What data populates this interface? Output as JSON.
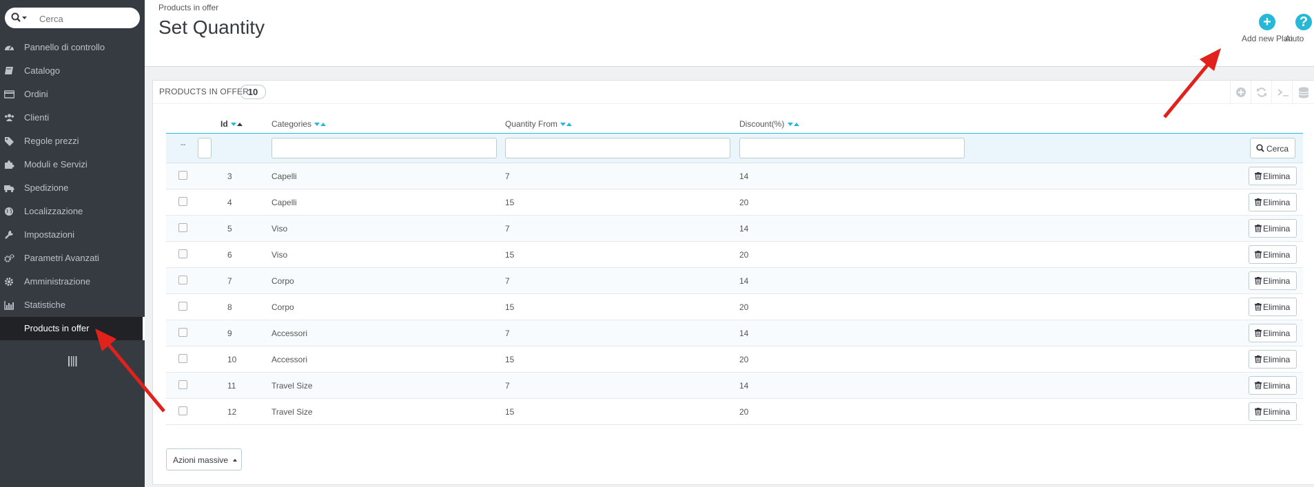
{
  "sidebar": {
    "search_placeholder": "Cerca",
    "items": [
      {
        "label": "Pannello di controllo",
        "icon": "dashboard-icon"
      },
      {
        "label": "Catalogo",
        "icon": "book-icon"
      },
      {
        "label": "Ordini",
        "icon": "credit-card-icon"
      },
      {
        "label": "Clienti",
        "icon": "users-icon"
      },
      {
        "label": "Regole prezzi",
        "icon": "tags-icon"
      },
      {
        "label": "Moduli e Servizi",
        "icon": "puzzle-icon"
      },
      {
        "label": "Spedizione",
        "icon": "truck-icon"
      },
      {
        "label": "Localizzazione",
        "icon": "globe-icon"
      },
      {
        "label": "Impostazioni",
        "icon": "wrench-icon"
      },
      {
        "label": "Parametri Avanzati",
        "icon": "cogs-icon"
      },
      {
        "label": "Amministrazione",
        "icon": "gear-icon"
      },
      {
        "label": "Statistiche",
        "icon": "bar-chart-icon"
      },
      {
        "label": "Products in offer",
        "icon": "",
        "active": true
      }
    ]
  },
  "header": {
    "breadcrumb": "Products in offer",
    "title": "Set Quantity",
    "add_label": "Add new Plan",
    "help_label": "Aiuto"
  },
  "panel": {
    "title": "Products in offer",
    "count": "10",
    "columns": {
      "id": "Id",
      "categories": "Categories",
      "quantity_from": "Quantity From",
      "discount": "Discount(%)"
    },
    "filter_dash": "--",
    "search_label": "Cerca",
    "delete_label": "Elimina",
    "bulk_label": "Azioni massive",
    "rows": [
      {
        "id": "3",
        "category": "Capelli",
        "quantity": "7",
        "discount": "14"
      },
      {
        "id": "4",
        "category": "Capelli",
        "quantity": "15",
        "discount": "20"
      },
      {
        "id": "5",
        "category": "Viso",
        "quantity": "7",
        "discount": "14"
      },
      {
        "id": "6",
        "category": "Viso",
        "quantity": "15",
        "discount": "20"
      },
      {
        "id": "7",
        "category": "Corpo",
        "quantity": "7",
        "discount": "14"
      },
      {
        "id": "8",
        "category": "Corpo",
        "quantity": "15",
        "discount": "20"
      },
      {
        "id": "9",
        "category": "Accessori",
        "quantity": "7",
        "discount": "14"
      },
      {
        "id": "10",
        "category": "Accessori",
        "quantity": "15",
        "discount": "20"
      },
      {
        "id": "11",
        "category": "Travel Size",
        "quantity": "7",
        "discount": "14"
      },
      {
        "id": "12",
        "category": "Travel Size",
        "quantity": "15",
        "discount": "20"
      }
    ]
  },
  "colors": {
    "accent": "#25b9d7",
    "sidebar_bg": "#363a41",
    "annotation_arrow": "#e0211c"
  }
}
